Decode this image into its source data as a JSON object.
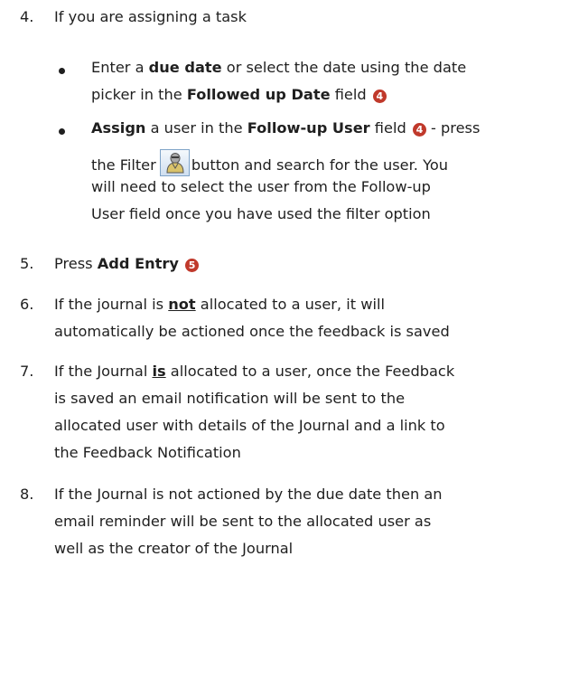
{
  "steps": [
    {
      "num": "4.",
      "text": "If you are assigning a task"
    },
    {
      "num": "5.",
      "pre": "Press ",
      "bold": "Add Entry",
      "marker": "5"
    },
    {
      "num": "6.",
      "pre": "If the journal is ",
      "bold_ul": "not",
      "post": " allocated to a user, it will",
      "line2": "automatically be actioned once the feedback is saved"
    },
    {
      "num": "7.",
      "pre": "If the Journal ",
      "bold_ul": "is",
      "post": " allocated to a user, once the Feedback",
      "line2": "is saved an email notification will be sent to the",
      "line3": "allocated user with details of the Journal and a link to",
      "line4": "the Feedback Notification"
    },
    {
      "num": "8.",
      "text": "If the Journal is not actioned by the due date then an",
      "line2": "email reminder will be sent to the allocated user as",
      "line3": "well as the creator of the Journal"
    }
  ],
  "bullets": [
    {
      "l1_pre": "Enter a ",
      "l1_bold": "due date",
      "l1_post": " or select the date using the date",
      "l2_pre": "picker in the ",
      "l2_bold": "Followed up Date",
      "l2_post": " field",
      "marker": "4"
    },
    {
      "l1_bold": "Assign",
      "l1_mid": " a user in the ",
      "l1_bold2": "Follow-up User",
      "l1_post": " field",
      "marker": "4",
      "l1_tail": " - press",
      "l2_pre": "the Filter",
      "l2_post": "button and search for the user. You",
      "l3": "will need to select the user from the Follow-up",
      "l4": "User field once you have used the filter option"
    }
  ],
  "icons": {
    "filter_button": "user-filter-icon",
    "step_marker": "numbered-circle-icon"
  },
  "colors": {
    "text": "#1f1f1f",
    "marker": "#c0392b"
  }
}
